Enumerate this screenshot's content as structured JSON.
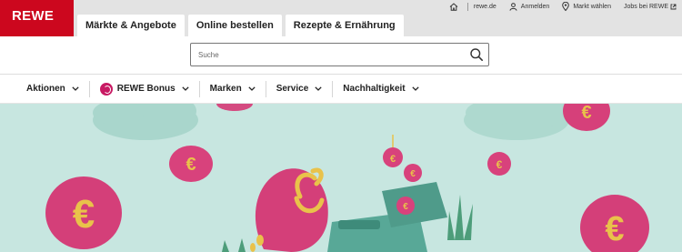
{
  "brand": {
    "logo_text": "REWE",
    "color": "#cc071e"
  },
  "header": {
    "tabs": [
      {
        "label": "Märkte & Angebote"
      },
      {
        "label": "Online bestellen"
      },
      {
        "label": "Rezepte & Ernährung"
      }
    ],
    "utility": {
      "home_label": "rewe.de",
      "login_label": "Anmelden",
      "market_label": "Markt wählen",
      "jobs_label": "Jobs bei REWE"
    }
  },
  "search": {
    "placeholder": "Suche",
    "value": ""
  },
  "categories": [
    {
      "label": "Aktionen"
    },
    {
      "label": "REWE Bonus"
    },
    {
      "label": "Marken"
    },
    {
      "label": "Service"
    },
    {
      "label": "Nachhaltigkeit"
    }
  ],
  "icons": {
    "home": "house-icon",
    "login": "user-icon",
    "market": "location-pin-icon",
    "search": "magnifier-icon",
    "dropdown": "chevron-down-icon",
    "jobs_external": "external-link-icon"
  },
  "hero": {
    "background_color": "#c7e6e0",
    "coin_color": "#d8427c",
    "wallet_color": "#58a897"
  }
}
